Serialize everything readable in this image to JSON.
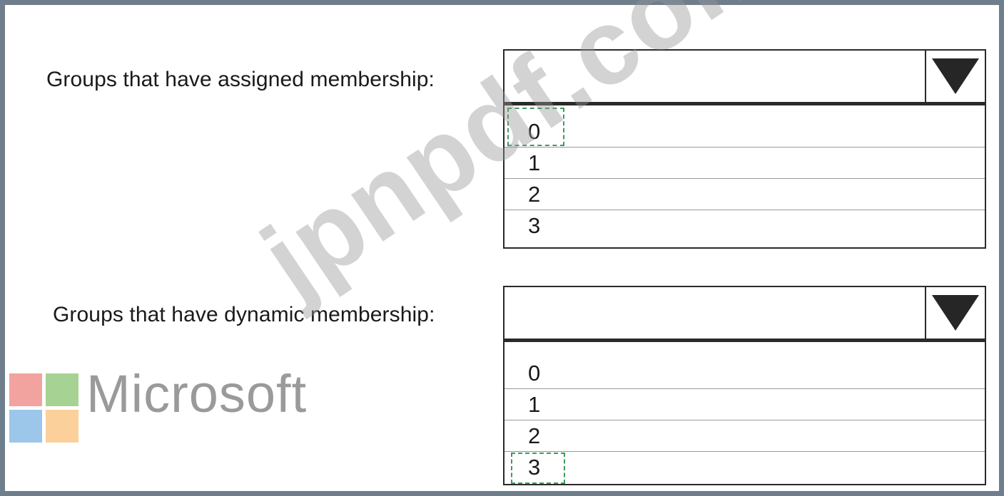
{
  "questions": [
    {
      "label": "Groups that have assigned membership:",
      "selected_value": "",
      "options": [
        "0",
        "1",
        "2",
        "3"
      ],
      "highlighted_option": "0"
    },
    {
      "label": "Groups that have dynamic membership:",
      "selected_value": "",
      "options": [
        "0",
        "1",
        "2",
        "3"
      ],
      "highlighted_option": "3"
    }
  ],
  "logo": {
    "text": "Microsoft",
    "colors": [
      "#f2a3a0",
      "#a6d294",
      "#9cc6ea",
      "#fbd09a"
    ]
  },
  "watermark": {
    "text": "jpnpdf.com"
  },
  "icons": {
    "dropdown": "triangle-down-icon"
  },
  "colors": {
    "frame_border": "#6e7e8c",
    "highlight_dash": "#3f9a5c"
  }
}
